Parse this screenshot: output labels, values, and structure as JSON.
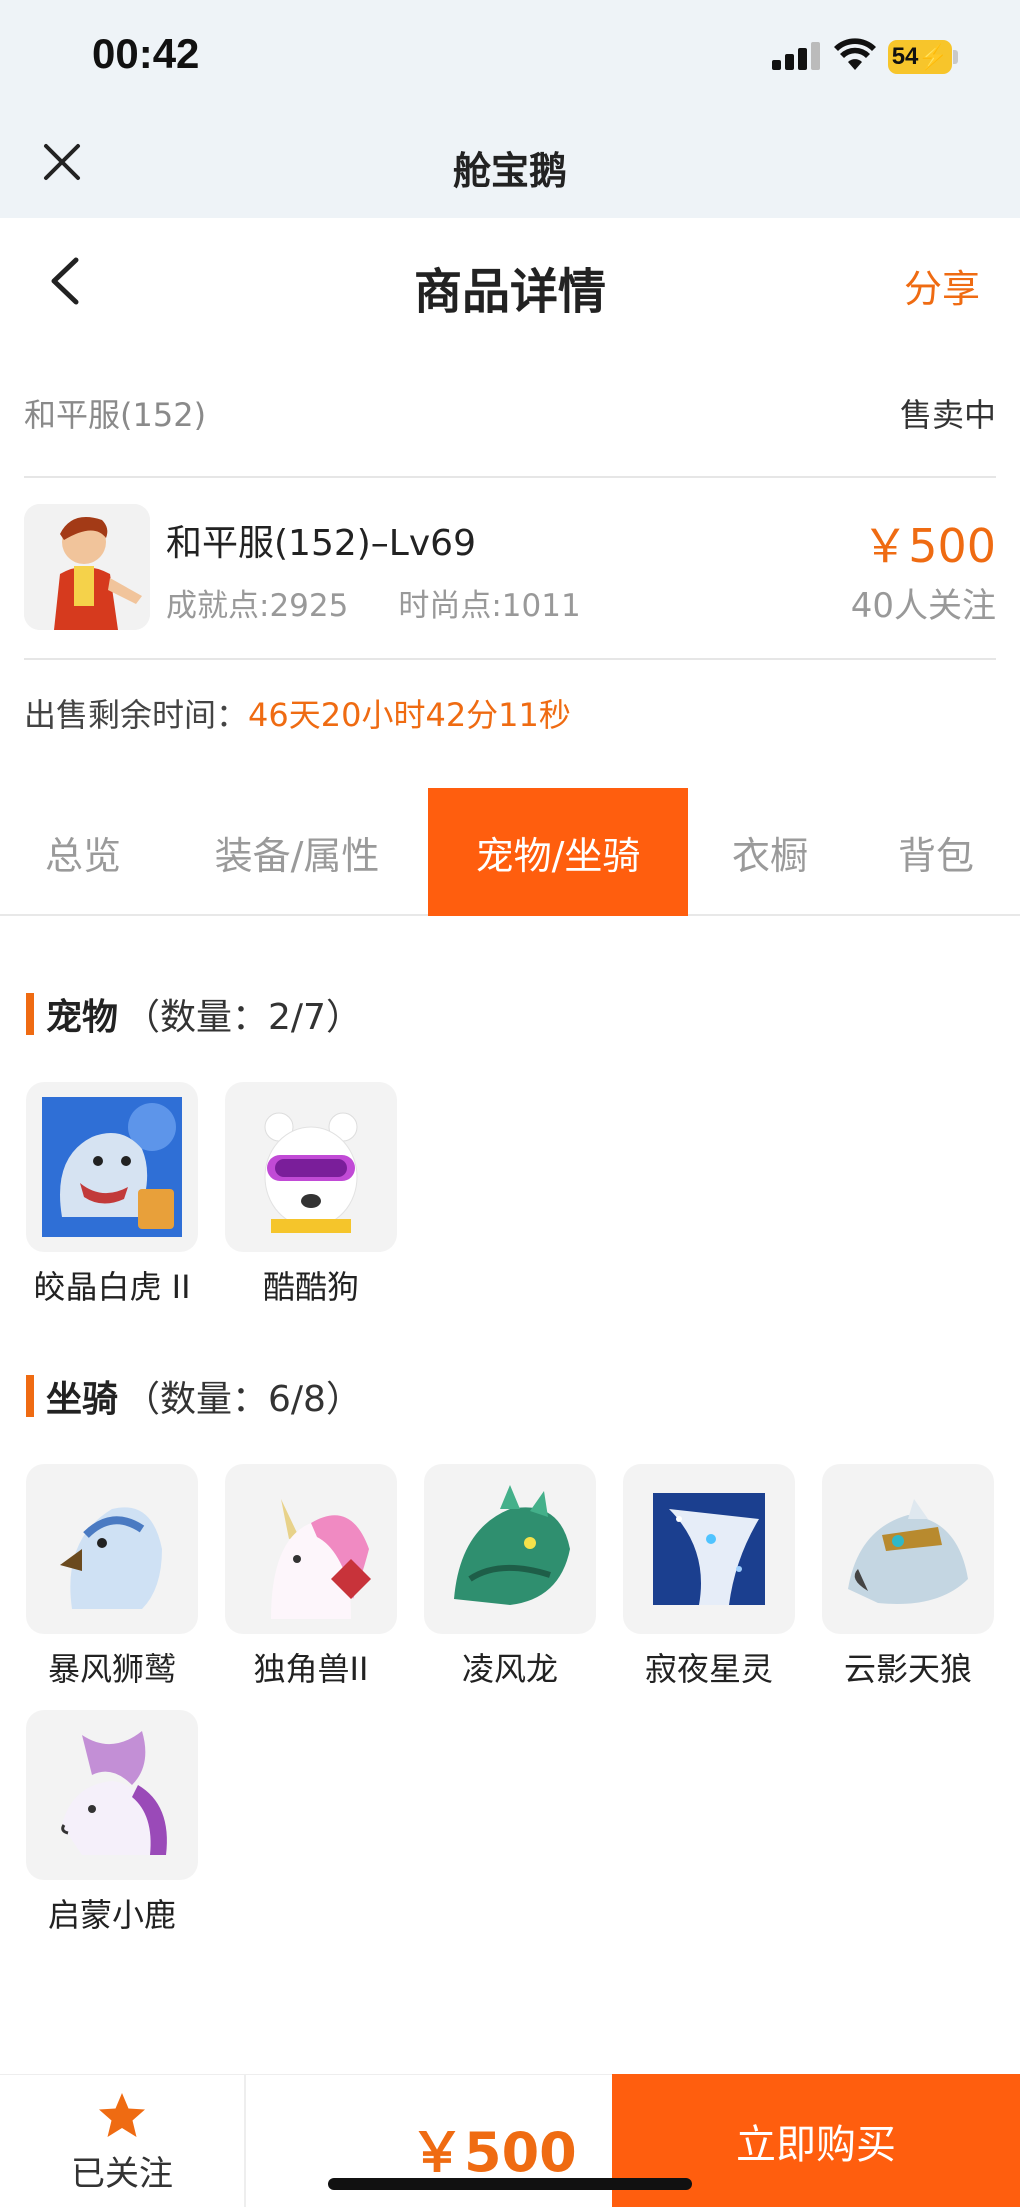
{
  "status_bar": {
    "time": "00:42",
    "battery": "54"
  },
  "mini_header": {
    "title": "舱宝鹅"
  },
  "nav": {
    "title": "商品详情",
    "share": "分享"
  },
  "listing": {
    "server": "和平服(152)",
    "status": "售卖中",
    "title": "和平服(152)–Lv69",
    "achievement": "成就点:2925",
    "fashion": "时尚点:1011",
    "price": "￥500",
    "watchers": "40人关注",
    "remaining_label": "出售剩余时间：",
    "remaining_value": "46天20小时42分11秒"
  },
  "tabs": [
    {
      "label": "总览",
      "active": false
    },
    {
      "label": "装备/属性",
      "active": false
    },
    {
      "label": "宠物/坐骑",
      "active": true
    },
    {
      "label": "衣橱",
      "active": false
    },
    {
      "label": "背包",
      "active": false
    }
  ],
  "pets": {
    "title": "宠物",
    "count": "（数量：2/7）",
    "items": [
      {
        "name": "皎晶白虎 II",
        "icon": "white-tiger-icon",
        "color": "#2f6fd6"
      },
      {
        "name": "酷酷狗",
        "icon": "cool-dog-icon",
        "color": "#ffffff"
      }
    ]
  },
  "mounts": {
    "title": "坐骑",
    "count": "（数量：6/8）",
    "items": [
      {
        "name": "暴风狮鹫",
        "icon": "griffin-icon",
        "color": "#b9d6f2"
      },
      {
        "name": "独角兽II",
        "icon": "unicorn-icon",
        "color": "#f3b3d6"
      },
      {
        "name": "凌风龙",
        "icon": "dragon-icon",
        "color": "#2f8f6f"
      },
      {
        "name": "寂夜星灵",
        "icon": "star-spirit-icon",
        "color": "#1b3f8f"
      },
      {
        "name": "云影天狼",
        "icon": "sky-wolf-icon",
        "color": "#9fb8c8"
      },
      {
        "name": "启蒙小鹿",
        "icon": "fawn-icon",
        "color": "#c38fd6"
      }
    ]
  },
  "bottom": {
    "follow_label": "已关注",
    "price": "￥500",
    "buy_label": "立即购买"
  },
  "colors": {
    "accent": "#ff5e0e",
    "price": "#ef6b12"
  }
}
